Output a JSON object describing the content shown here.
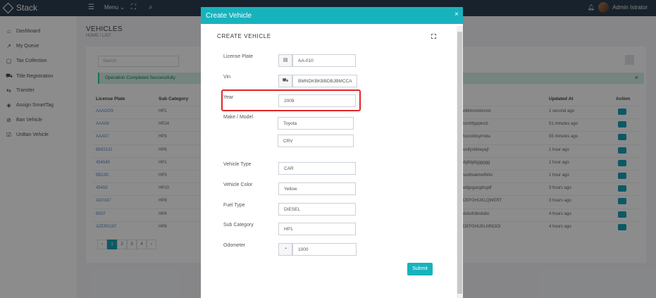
{
  "app": {
    "brand": "Stack",
    "menu_label": "Menu",
    "user_name": "Admin Istrator"
  },
  "sidebar": {
    "items": [
      {
        "label": "Dashboard",
        "icon": "home-icon"
      },
      {
        "label": "My Queue",
        "icon": "trend-icon"
      },
      {
        "label": "Tax Collection",
        "icon": "box-icon"
      },
      {
        "label": "Title Registration",
        "icon": "car-icon"
      },
      {
        "label": "Transfer",
        "icon": "transfer-icon"
      },
      {
        "label": "Assign SmartTag",
        "icon": "tag-icon"
      },
      {
        "label": "Ban Vehicle",
        "icon": "ban-icon"
      },
      {
        "label": "UnBan Vehicle",
        "icon": "check-square-icon"
      }
    ]
  },
  "page": {
    "title": "VEHICLES",
    "breadcrumb_home": "HOME",
    "breadcrumb_list": "LIST",
    "search_placeholder": "Search",
    "alert": "Operation Completed Successfully",
    "table": {
      "headers": {
        "license": "License Plate",
        "sub_category": "Sub Category",
        "updated": "Updated At",
        "action": "Action"
      },
      "rows": [
        {
          "plate": "AAAOO9",
          "sub": "HP1",
          "code": "efdmnnolonost",
          "updated": "1 second ago"
        },
        {
          "plate": "AAA08",
          "sub": "HP24",
          "code": "ncnhfpppincb",
          "updated": "51 minutes ago"
        },
        {
          "plate": "AAA07",
          "sub": "HP3",
          "code": "fuzcoblsyrmda",
          "updated": "55 minutes ago"
        },
        {
          "plate": "BMO13J",
          "sub": "HP6",
          "code": "unifysbiheyajf",
          "updated": "1 hour ago"
        },
        {
          "plate": "454545",
          "sub": "HP1",
          "code": "dgfdgdgggggg",
          "updated": "1 hour ago"
        },
        {
          "plate": "BB18C",
          "sub": "HP3",
          "code": "sodhrakmefbhis",
          "updated": "1 hour ago"
        },
        {
          "plate": "45455",
          "sub": "HP10",
          "code": "edgsgasgdsgdf",
          "updated": "3 hours ago"
        },
        {
          "plate": "AD0187",
          "sub": "HP8",
          "code": "DEFGHIJKLQWERT",
          "updated": "3 hours ago"
        },
        {
          "plate": "B007",
          "sub": "HP4",
          "code": "dskofolbolsibc",
          "updated": "4 hours ago"
        },
        {
          "plate": "AZER0197",
          "sub": "HP6",
          "code": "DEFGHIJKLMNOOI",
          "updated": "4 hours ago"
        }
      ]
    },
    "pager": [
      "‹",
      "1",
      "2",
      "3",
      "4",
      "›"
    ]
  },
  "modal": {
    "header": "Create Vehicle",
    "inner_title": "CREATE VEHICLE",
    "fields": {
      "license_plate": {
        "label": "License Plate",
        "value": "AA-010"
      },
      "vin": {
        "label": "Vin",
        "value": "BMNDKBKBBDBJBMCCA"
      },
      "year": {
        "label": "Year",
        "value": "2009"
      },
      "make_model": {
        "label": "Make / Model",
        "make": "Toyota",
        "model": "CRV"
      },
      "vehicle_type": {
        "label": "Vehicle Type",
        "value": "CAR"
      },
      "vehicle_color": {
        "label": "Vehicle Color",
        "value": "Yellow"
      },
      "fuel_type": {
        "label": "Fuel Type",
        "value": "DIESEL"
      },
      "sub_category": {
        "label": "Sub Category",
        "value": "HP1"
      },
      "odometer": {
        "label": "Odometer",
        "value": "1000"
      }
    },
    "submit_label": "Submit"
  },
  "colors": {
    "topbar": "#2c3e50",
    "accent": "#17b3bd",
    "success": "#28d094",
    "highlight": "#e0262b"
  }
}
